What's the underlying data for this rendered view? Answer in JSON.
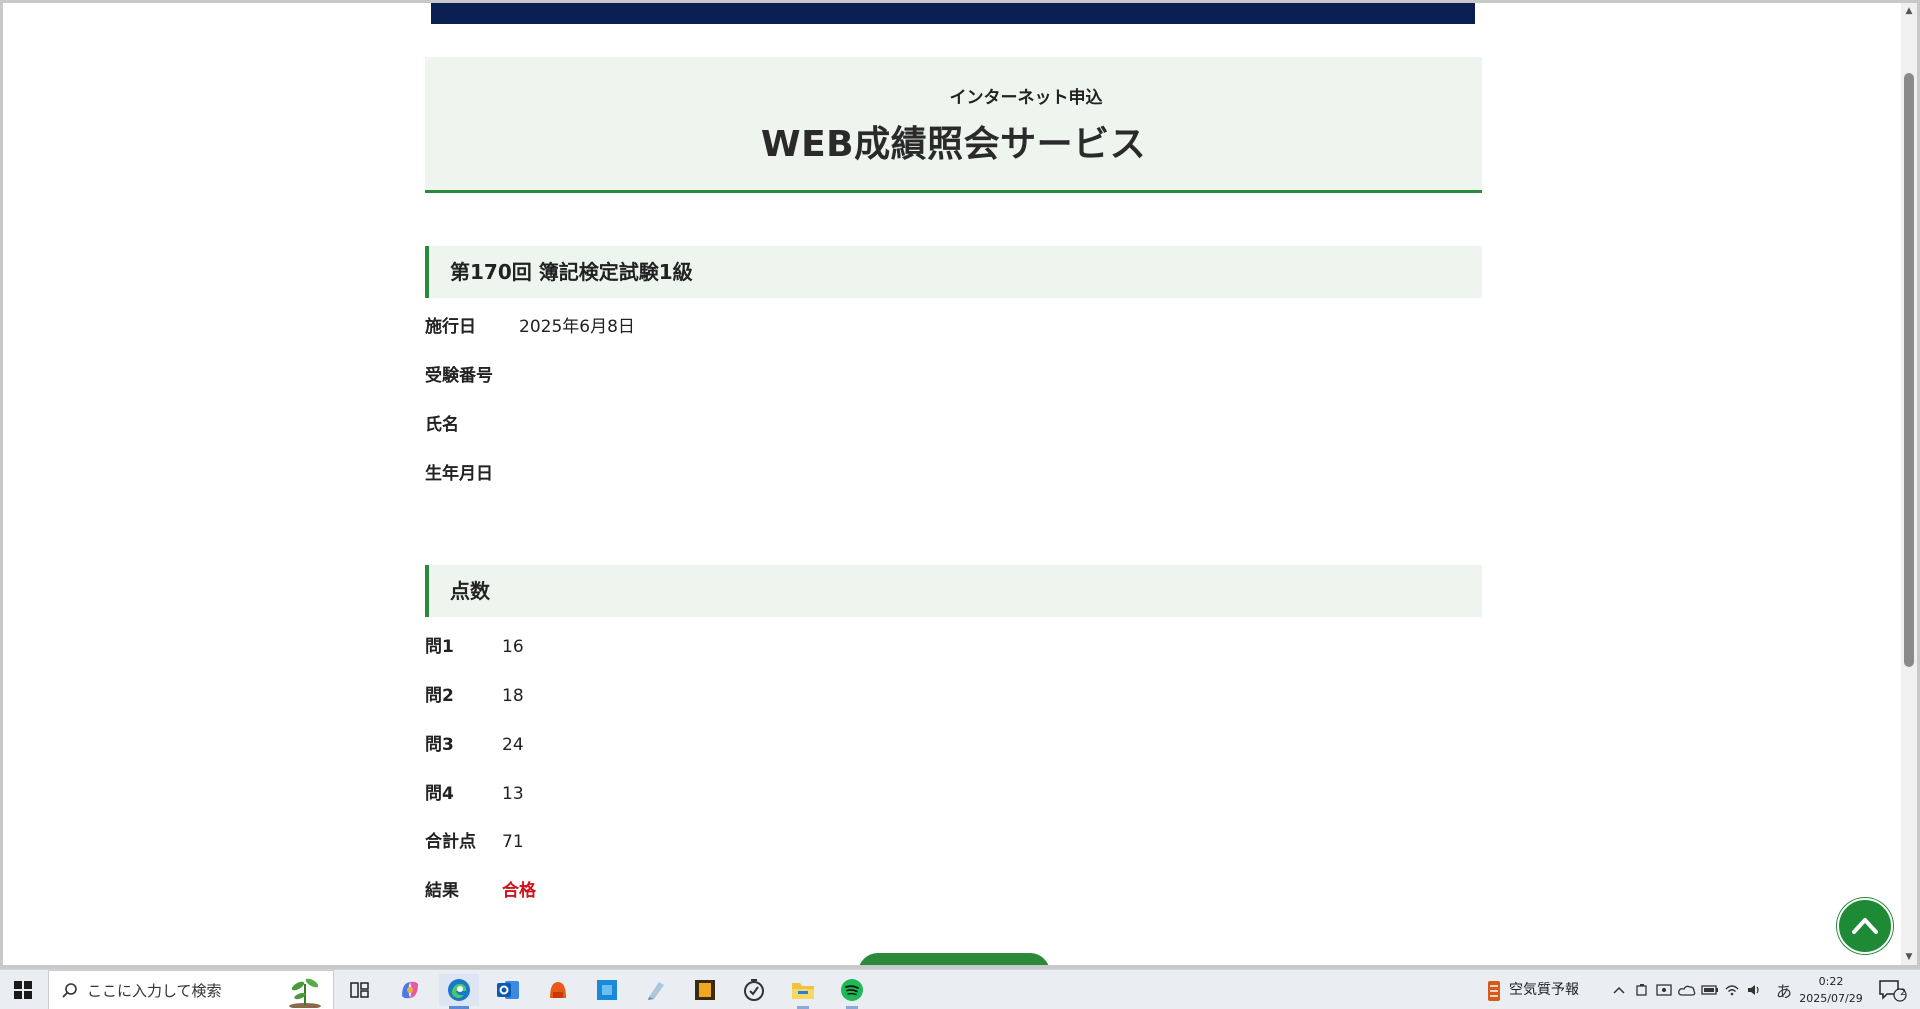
{
  "header": {
    "subtitle": "インターネット申込",
    "title": "WEB成績照会サービス"
  },
  "exam": {
    "heading": "第170回 簿記検定試験1級",
    "fields": [
      {
        "label": "施行日",
        "value": "2025年6月8日"
      },
      {
        "label": "受験番号",
        "value": ""
      },
      {
        "label": "氏名",
        "value": ""
      },
      {
        "label": "生年月日",
        "value": ""
      }
    ]
  },
  "scores": {
    "heading": "点数",
    "rows": [
      {
        "label": "問1",
        "value": "16"
      },
      {
        "label": "問2",
        "value": "18"
      },
      {
        "label": "問3",
        "value": "24"
      },
      {
        "label": "問4",
        "value": "13"
      },
      {
        "label": "合計点",
        "value": "71"
      },
      {
        "label": "結果",
        "value": "合格"
      }
    ],
    "pass_color": "#d4101a"
  },
  "theme": {
    "accent": "#2a8a3a",
    "navy": "#0a1e52",
    "panel_bg": "#eef5ef"
  },
  "taskbar": {
    "search_placeholder": "ここに入力して検索",
    "apps": [
      "task-view-icon",
      "copilot-icon",
      "edge-icon",
      "outlook-icon",
      "app-orange-icon",
      "app-blue-icon",
      "app-note-icon",
      "app-sticky-icon",
      "clock-app-icon",
      "file-explorer-icon",
      "spotify-icon"
    ],
    "weather_text": "空気質予報",
    "ime": "あ",
    "time": "0:22",
    "date": "2025/07/29",
    "notification_count": "2"
  }
}
